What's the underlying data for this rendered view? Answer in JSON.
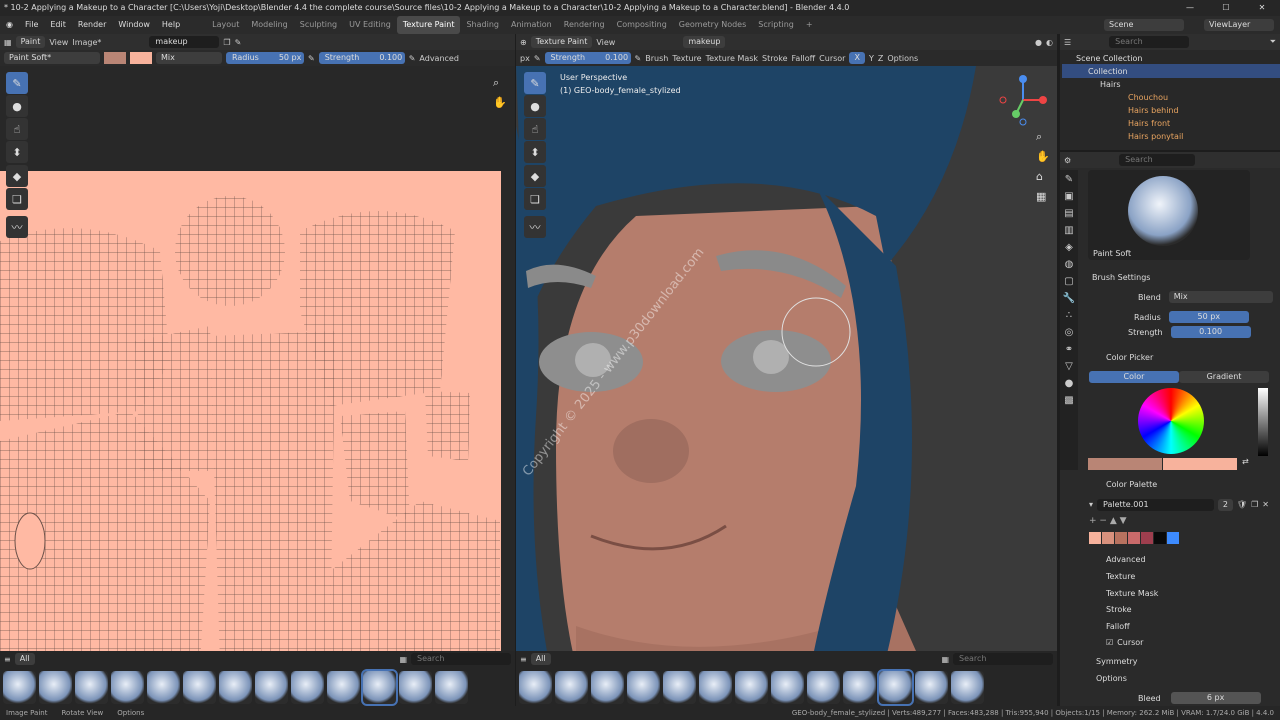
{
  "window": {
    "title": "* 10-2 Applying a Makeup to a Character [C:\\Users\\Yoji\\Desktop\\Blender 4.4 the complete course\\Source files\\10-2 Applying a Makeup to a Character\\10-2 Applying a Makeup to a Character.blend] - Blender 4.4.0"
  },
  "menus": [
    "File",
    "Edit",
    "Render",
    "Window",
    "Help"
  ],
  "workspaces": [
    "Layout",
    "Modeling",
    "Sculpting",
    "UV Editing",
    "Texture Paint",
    "Shading",
    "Animation",
    "Rendering",
    "Compositing",
    "Geometry Nodes",
    "Scripting"
  ],
  "active_workspace": "Texture Paint",
  "scene": "Scene",
  "view_layer": "ViewLayer",
  "left_editor": {
    "mode": "Paint",
    "view": "View",
    "image_menu": "Image*",
    "image_name": "makeup",
    "brush": "Paint Soft*",
    "blend": "Mix",
    "radius_label": "Radius",
    "radius": "50 px",
    "strength_label": "Strength",
    "strength": "0.100",
    "advanced": "Advanced",
    "all_label": "All",
    "search_placeholder": "Search"
  },
  "viewport": {
    "mode": "Texture Paint",
    "view": "View",
    "uv_map": "makeup",
    "px": "px",
    "strength_label": "Strength",
    "strength": "0.100",
    "menus": [
      "Brush",
      "Texture",
      "Texture Mask",
      "Stroke",
      "Falloff",
      "Cursor"
    ],
    "axes": [
      "X",
      "Y",
      "Z"
    ],
    "options": "Options",
    "perspective": "User Perspective",
    "object": "(1) GEO-body_female_stylized",
    "watermark": "Copyright © 2025 - www.p30download.com",
    "all_label": "All",
    "search_placeholder": "Search"
  },
  "outliner": {
    "search_placeholder": "Search",
    "items": [
      {
        "label": "Scene Collection"
      },
      {
        "label": "Collection"
      },
      {
        "label": "Hairs"
      },
      {
        "label": "Chouchou"
      },
      {
        "label": "Hairs behind"
      },
      {
        "label": "Hairs front"
      },
      {
        "label": "Hairs ponytail"
      }
    ]
  },
  "properties": {
    "search_placeholder": "Search",
    "brush_name": "Paint Soft",
    "brush_settings": "Brush Settings",
    "blend_label": "Blend",
    "blend": "Mix",
    "radius_label": "Radius",
    "radius": "50 px",
    "strength_label": "Strength",
    "strength": "0.100",
    "color_picker": "Color Picker",
    "tab_color": "Color",
    "tab_gradient": "Gradient",
    "color_palette": "Color Palette",
    "palette_name": "Palette.001",
    "palette_users": "2",
    "palette_colors": [
      "#f7b29c",
      "#d9917d",
      "#b8725f",
      "#c96a6a",
      "#9e3e4e",
      "#0a0a0a",
      "#3d8bff"
    ],
    "sections": [
      "Advanced",
      "Texture",
      "Texture Mask",
      "Stroke",
      "Falloff",
      "Cursor",
      "Symmetry",
      "Options"
    ],
    "bleed_label": "Bleed",
    "bleed": "6 px"
  },
  "colors": {
    "primary": "#b98575",
    "secondary": "#f7b29c",
    "accent": "#4772b3",
    "uv_bg": "#ffb9a3"
  },
  "status": {
    "left": [
      "Image Paint",
      "Rotate View",
      "Options"
    ],
    "right": "GEO-body_female_stylized | Verts:489,277 | Faces:483,288 | Tris:955,940 | Objects:1/15 | Memory: 262.2 MiB | VRAM: 1.7/24.0 GiB | 4.4.0"
  }
}
